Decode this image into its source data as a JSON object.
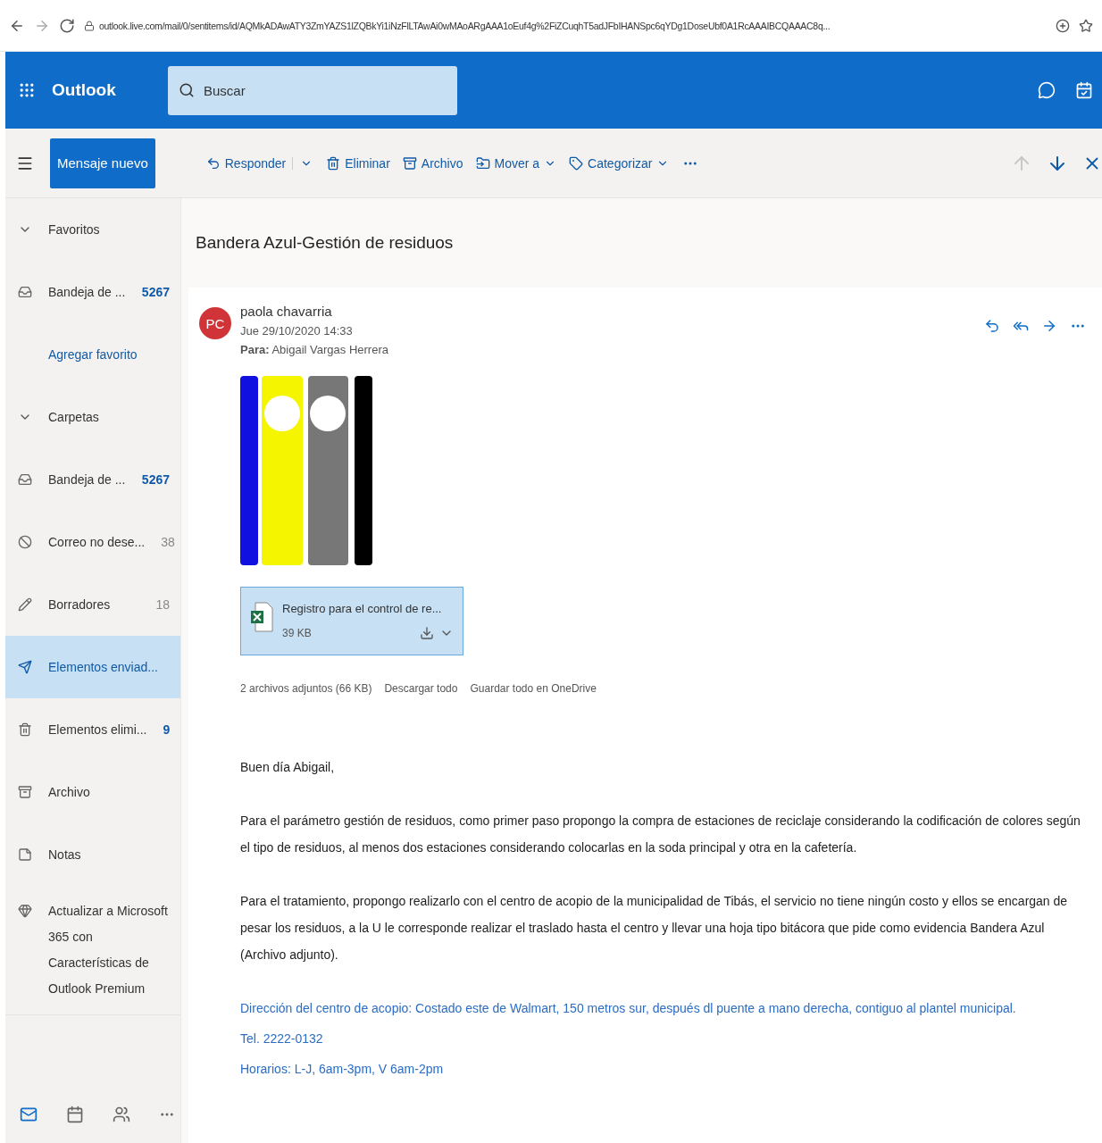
{
  "browser": {
    "url": "outlook.live.com/mail/0/sentitems/id/AQMkADAwATY3ZmYAZS1lZQBkYi1iNzFlLTAwAi0wMAoARgAAA1oEuf4g%2FiZCuqhT5adJFbIHANSpc6qYDg1DoseUbf0A1RcAAAIBCQAAAC8q..."
  },
  "header": {
    "app_name": "Outlook",
    "search": {
      "placeholder": "Buscar"
    }
  },
  "toolbar": {
    "new_message": "Mensaje nuevo",
    "actions": [
      {
        "kind": "reply",
        "label": "Responder"
      },
      {
        "kind": "delete",
        "label": "Eliminar"
      },
      {
        "kind": "archive",
        "label": "Archivo"
      },
      {
        "kind": "move",
        "label": "Mover a"
      },
      {
        "kind": "categorize",
        "label": "Categorizar"
      }
    ],
    "nav": [
      {
        "kind": "up",
        "disabled": true
      },
      {
        "kind": "down",
        "disabled": false
      }
    ]
  },
  "sidebar": {
    "items": [
      {
        "kind": "section",
        "label": "Favoritos",
        "expanded": true
      },
      {
        "kind": "inbox",
        "label": "Bandeja de ...",
        "count": "5267",
        "unread": true,
        "selected": false
      },
      {
        "kind": "link",
        "label": "Agregar favorito"
      },
      {
        "kind": "section",
        "label": "Carpetas",
        "expanded": true
      },
      {
        "kind": "inbox",
        "label": "Bandeja de ...",
        "count": "5267",
        "unread": true,
        "selected": false
      },
      {
        "kind": "junk",
        "label": "Correo no dese...",
        "count": "38",
        "unread": false,
        "selected": false
      },
      {
        "kind": "drafts",
        "label": "Borradores",
        "count": "18",
        "unread": false,
        "selected": false
      },
      {
        "kind": "sent",
        "label": "Elementos enviad...",
        "selected": true
      },
      {
        "kind": "deleted",
        "label": "Elementos elimi...",
        "count": "9",
        "unread": true,
        "selected": false
      },
      {
        "kind": "archive",
        "label": "Archivo",
        "selected": false
      },
      {
        "kind": "notes",
        "label": "Notas",
        "selected": false
      },
      {
        "kind": "promo",
        "label": "Actualizar a Microsoft 365 con Características de Outlook Premium"
      }
    ],
    "apps": [
      {
        "kind": "mail",
        "selected": true
      },
      {
        "kind": "calendar",
        "selected": false
      },
      {
        "kind": "people",
        "selected": false
      }
    ]
  },
  "message": {
    "subject": "Bandera Azul-Gestión de residuos",
    "avatar": "PC",
    "sender": "paola chavarria",
    "date": "Jue 29/10/2020 14:33",
    "to_label": "Para:",
    "to": "Abigail Vargas Herrera",
    "attachment": {
      "name": "Registro para el control de re...",
      "size": "39 KB"
    },
    "attachments_summary": "2 archivos adjuntos (66 KB)",
    "download_all": "Descargar todo",
    "save_all": "Guardar todo en OneDrive",
    "body": [
      {
        "kind": "text",
        "text": "Buen día Abigail,"
      },
      {
        "kind": "text",
        "text": "Para el parámetro gestión de residuos, como primer paso propongo la compra de estaciones de reciclaje considerando la codificación de colores según el tipo de residuos, al menos dos estaciones considerando colocarlas en la soda principal y otra en la cafetería."
      },
      {
        "kind": "text",
        "text": "Para el tratamiento, propongo realizarlo con el centro de acopio de la municipalidad de Tibás, el servicio no tiene ningún costo y ellos se encargan de pesar los residuos, a la U le corresponde realizar el traslado hasta el centro y llevar una hoja tipo bitácora que pide como evidencia Bandera Azul (Archivo adjunto)."
      },
      {
        "kind": "link",
        "text": "Dirección del centro de acopio: Costado este de Walmart, 150 metros sur, después dl puente a mano derecha, contiguo al plantel municipal."
      },
      {
        "kind": "link",
        "text": "Tel. 2222-0132"
      },
      {
        "kind": "link",
        "text": "Horarios: L-J, 6am-3pm, V 6am-2pm"
      }
    ]
  }
}
